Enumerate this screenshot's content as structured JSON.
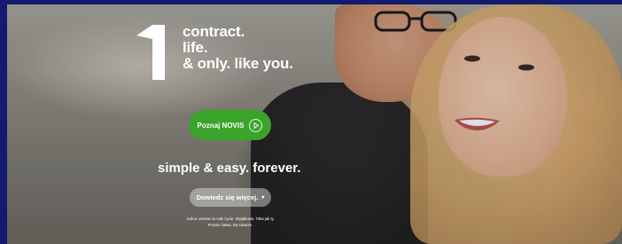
{
  "hero": {
    "tagline": [
      "contract.",
      "life.",
      "& only. like you."
    ],
    "cta_label": "Poznaj NOVIS",
    "slogan": "simple & easy. forever.",
    "more_label": "Dowiedz się więcej.",
    "fine_print": [
      "Jedna umowa na całe życie. Wyjątkowa. Taka jak ty.",
      "Prosta i łatwa. Na zawsze."
    ]
  },
  "icons": {
    "logo": "novis-1-logo-icon",
    "cta": "play-circle-icon",
    "more": "chevron-down-icon"
  },
  "colors": {
    "frame": "#141a6e",
    "cta_green": "#3aa32a",
    "text": "#ffffff"
  }
}
